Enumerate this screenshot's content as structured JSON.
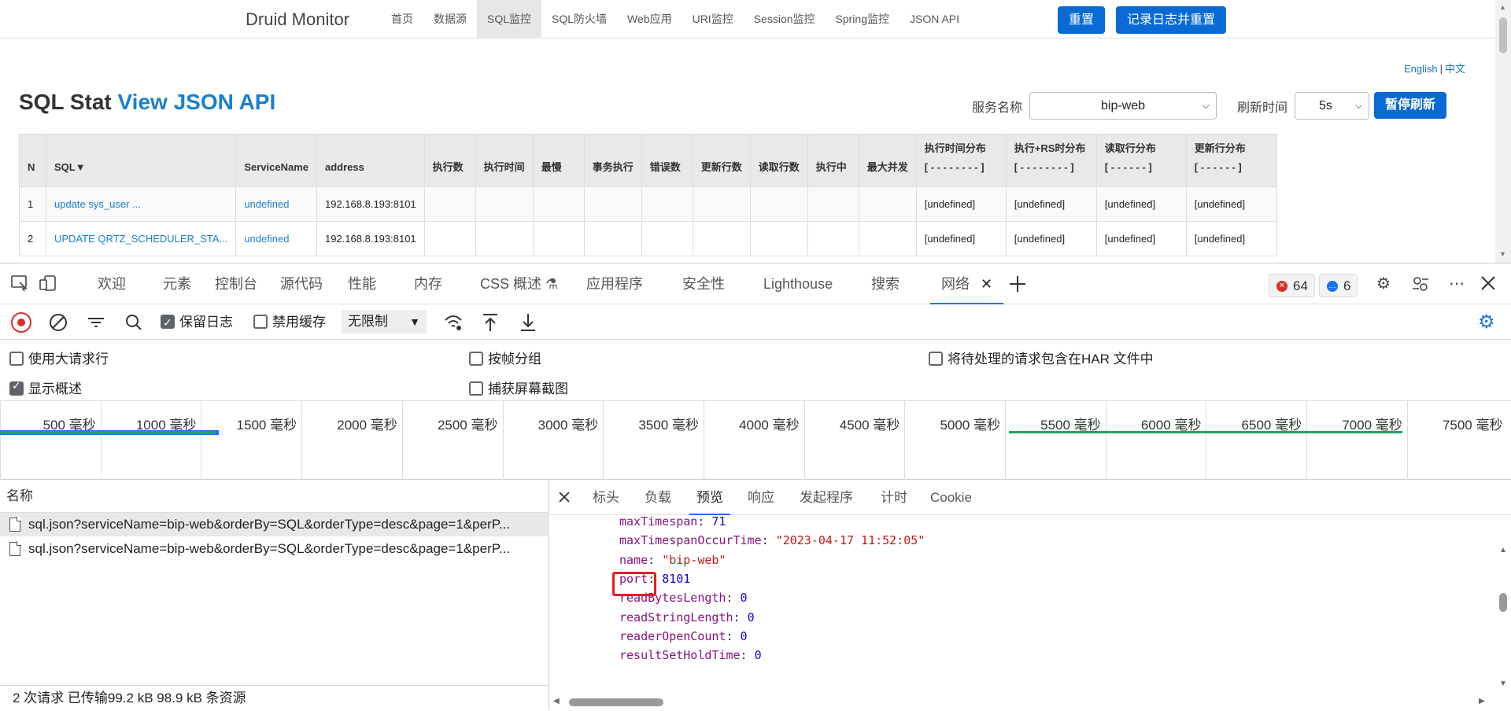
{
  "druid": {
    "brand": "Druid Monitor",
    "nav": [
      "首页",
      "数据源",
      "SQL监控",
      "SQL防火墙",
      "Web应用",
      "URI监控",
      "Session监控",
      "Spring监控",
      "JSON API"
    ],
    "nav_active_index": 2,
    "reset_button": "重置",
    "log_reset_button": "记录日志并重置",
    "lang_english": "English",
    "lang_sep": "|",
    "lang_chinese": "中文",
    "title_main": "SQL Stat",
    "title_link": "View JSON API",
    "service_label": "服务名称",
    "service_value": "bip-web",
    "refresh_label": "刷新时间",
    "refresh_value": "5s",
    "pause_button": "暂停刷新",
    "table": {
      "headers": [
        {
          "l1": "",
          "l2": "N"
        },
        {
          "l1": "",
          "l2": "SQL▼"
        },
        {
          "l1": "",
          "l2": "ServiceName"
        },
        {
          "l1": "",
          "l2": "address"
        },
        {
          "l1": "",
          "l2": "执行数"
        },
        {
          "l1": "",
          "l2": "执行时间"
        },
        {
          "l1": "",
          "l2": "最慢"
        },
        {
          "l1": "",
          "l2": "事务执行"
        },
        {
          "l1": "",
          "l2": "错误数"
        },
        {
          "l1": "",
          "l2": "更新行数"
        },
        {
          "l1": "",
          "l2": "读取行数"
        },
        {
          "l1": "",
          "l2": "执行中"
        },
        {
          "l1": "",
          "l2": "最大并发"
        },
        {
          "l1": "执行时间分布",
          "l2": "[ - - - - - - - - ]"
        },
        {
          "l1": "执行+RS时分布",
          "l2": "[ - - - - - - - - ]"
        },
        {
          "l1": "读取行分布",
          "l2": "[ - - - - - - ]"
        },
        {
          "l1": "更新行分布",
          "l2": "[ - - - - - - ]"
        }
      ],
      "rows": [
        [
          "1",
          "update sys_user ...",
          "undefined",
          "192.168.8.193:8101",
          "",
          "",
          "",
          "",
          "",
          "",
          "",
          "",
          "",
          "[undefined]",
          "[undefined]",
          "[undefined]",
          "[undefined]"
        ],
        [
          "2",
          "UPDATE QRTZ_SCHEDULER_STA...",
          "undefined",
          "192.168.8.193:8101",
          "",
          "",
          "",
          "",
          "",
          "",
          "",
          "",
          "",
          "[undefined]",
          "[undefined]",
          "[undefined]",
          "[undefined]"
        ]
      ]
    }
  },
  "devtools": {
    "tabs": [
      "欢迎",
      "元素",
      "控制台",
      "源代码",
      "性能",
      "内存",
      "CSS 概述",
      "应用程序",
      "安全性",
      "Lighthouse",
      "搜索",
      "网络"
    ],
    "active_tab": "网络",
    "error_count": "64",
    "message_count": "6",
    "toolbar": {
      "preserve_log": "保留日志",
      "disable_cache": "禁用缓存",
      "throttle": "无限制"
    },
    "options": {
      "large_rows": "使用大请求行",
      "group_by_frame": "按帧分组",
      "include_pending_har": "将待处理的请求包含在HAR 文件中",
      "show_overview": "显示概述",
      "capture_screenshots": "捕获屏幕截图"
    },
    "timeline_labels": [
      "500 毫秒",
      "1000 毫秒",
      "1500 毫秒",
      "2000 毫秒",
      "2500 毫秒",
      "3000 毫秒",
      "3500 毫秒",
      "4000 毫秒",
      "4500 毫秒",
      "5000 毫秒",
      "5500 毫秒",
      "6000 毫秒",
      "6500 毫秒",
      "7000 毫秒",
      "7500 毫秒"
    ],
    "colors": {
      "bar_green": "#1da462",
      "bar_blue": "#1a73e8",
      "accent": "#1a73e8",
      "highlight": "#e51c23"
    },
    "name_header": "名称",
    "requests": [
      "sql.json?serviceName=bip-web&orderBy=SQL&orderType=desc&page=1&perP...",
      "sql.json?serviceName=bip-web&orderBy=SQL&orderType=desc&page=1&perP..."
    ],
    "status": "2 次请求  已传输99.2 kB  98.9 kB 条资源",
    "detail_tabs": [
      "标头",
      "负载",
      "预览",
      "响应",
      "发起程序",
      "计时",
      "Cookie"
    ],
    "active_detail_tab": "预览",
    "preview_lines": [
      {
        "key": "maxTimespan",
        "value": "71",
        "kind": "num"
      },
      {
        "key": "maxTimespanOccurTime",
        "value": "\"2023-04-17 11:52:05\"",
        "kind": "str"
      },
      {
        "key": "name",
        "value": "\"bip-web\"",
        "kind": "str"
      },
      {
        "key": "port",
        "value": "8101",
        "kind": "num"
      },
      {
        "key": "readBytesLength",
        "value": "0",
        "kind": "num"
      },
      {
        "key": "readStringLength",
        "value": "0",
        "kind": "num"
      },
      {
        "key": "readerOpenCount",
        "value": "0",
        "kind": "num"
      },
      {
        "key": "resultSetHoldTime",
        "value": "0",
        "kind": "num"
      },
      {
        "key": "",
        "value": "",
        "kind": "num"
      }
    ]
  }
}
